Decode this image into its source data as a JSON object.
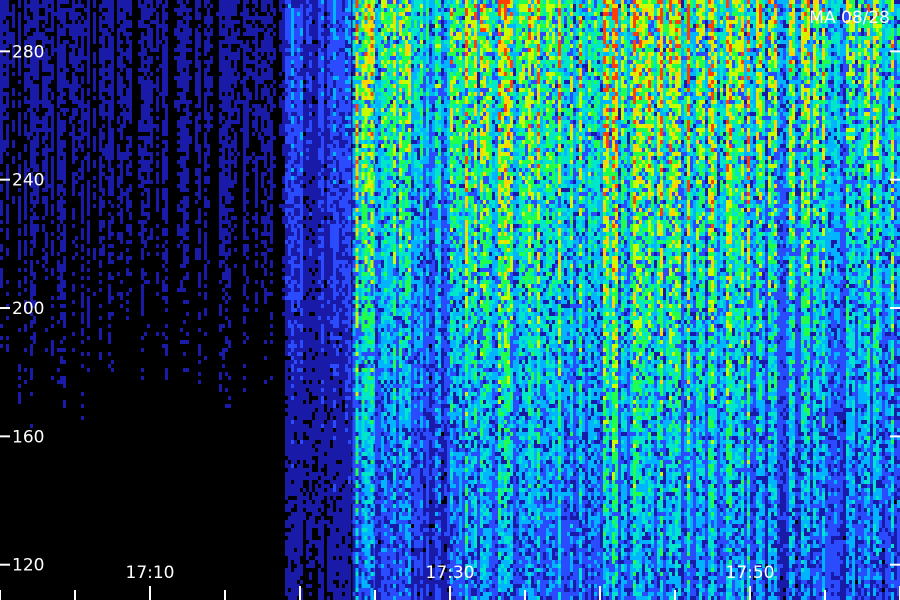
{
  "chart_data": {
    "type": "heatmap",
    "title": "",
    "xlabel": "",
    "ylabel": "",
    "corner_label": "MA 08/28",
    "y_ticks": [
      120,
      160,
      200,
      240,
      280
    ],
    "y_tick_labels": [
      "120",
      "160",
      "200",
      "240",
      "280"
    ],
    "x_ticks": [
      "17:10",
      "17:30",
      "17:50"
    ],
    "x_tick_labels": [
      "17:10",
      "17:30",
      "17:50"
    ],
    "ylim": [
      109,
      296
    ],
    "xlim": [
      "17:00",
      "17:60"
    ],
    "colormap": [
      "#000000",
      "#1a1aa8",
      "#2b4bff",
      "#00b4ff",
      "#00e6c8",
      "#22ff4a",
      "#c8ff00",
      "#ffd200",
      "#ff4000"
    ],
    "bands": [
      {
        "t_start": "17:00",
        "t_end": "17:19",
        "level_low_freq": 0.02,
        "level_high_freq": 0.1
      },
      {
        "t_start": "17:19",
        "t_end": "17:23.5",
        "level_low_freq": 0.1,
        "level_high_freq": 0.3
      },
      {
        "t_start": "17:23.5",
        "t_end": "17:25",
        "level_low_freq": 0.35,
        "level_high_freq": 0.85
      },
      {
        "t_start": "17:25",
        "t_end": "17:31",
        "level_low_freq": 0.25,
        "level_high_freq": 0.7
      },
      {
        "t_start": "17:31",
        "t_end": "17:40",
        "level_low_freq": 0.35,
        "level_high_freq": 0.8
      },
      {
        "t_start": "17:40",
        "t_end": "17:50",
        "level_low_freq": 0.4,
        "level_high_freq": 0.85
      },
      {
        "t_start": "17:50",
        "t_end": "17:60",
        "level_low_freq": 0.3,
        "level_high_freq": 0.7
      }
    ]
  }
}
